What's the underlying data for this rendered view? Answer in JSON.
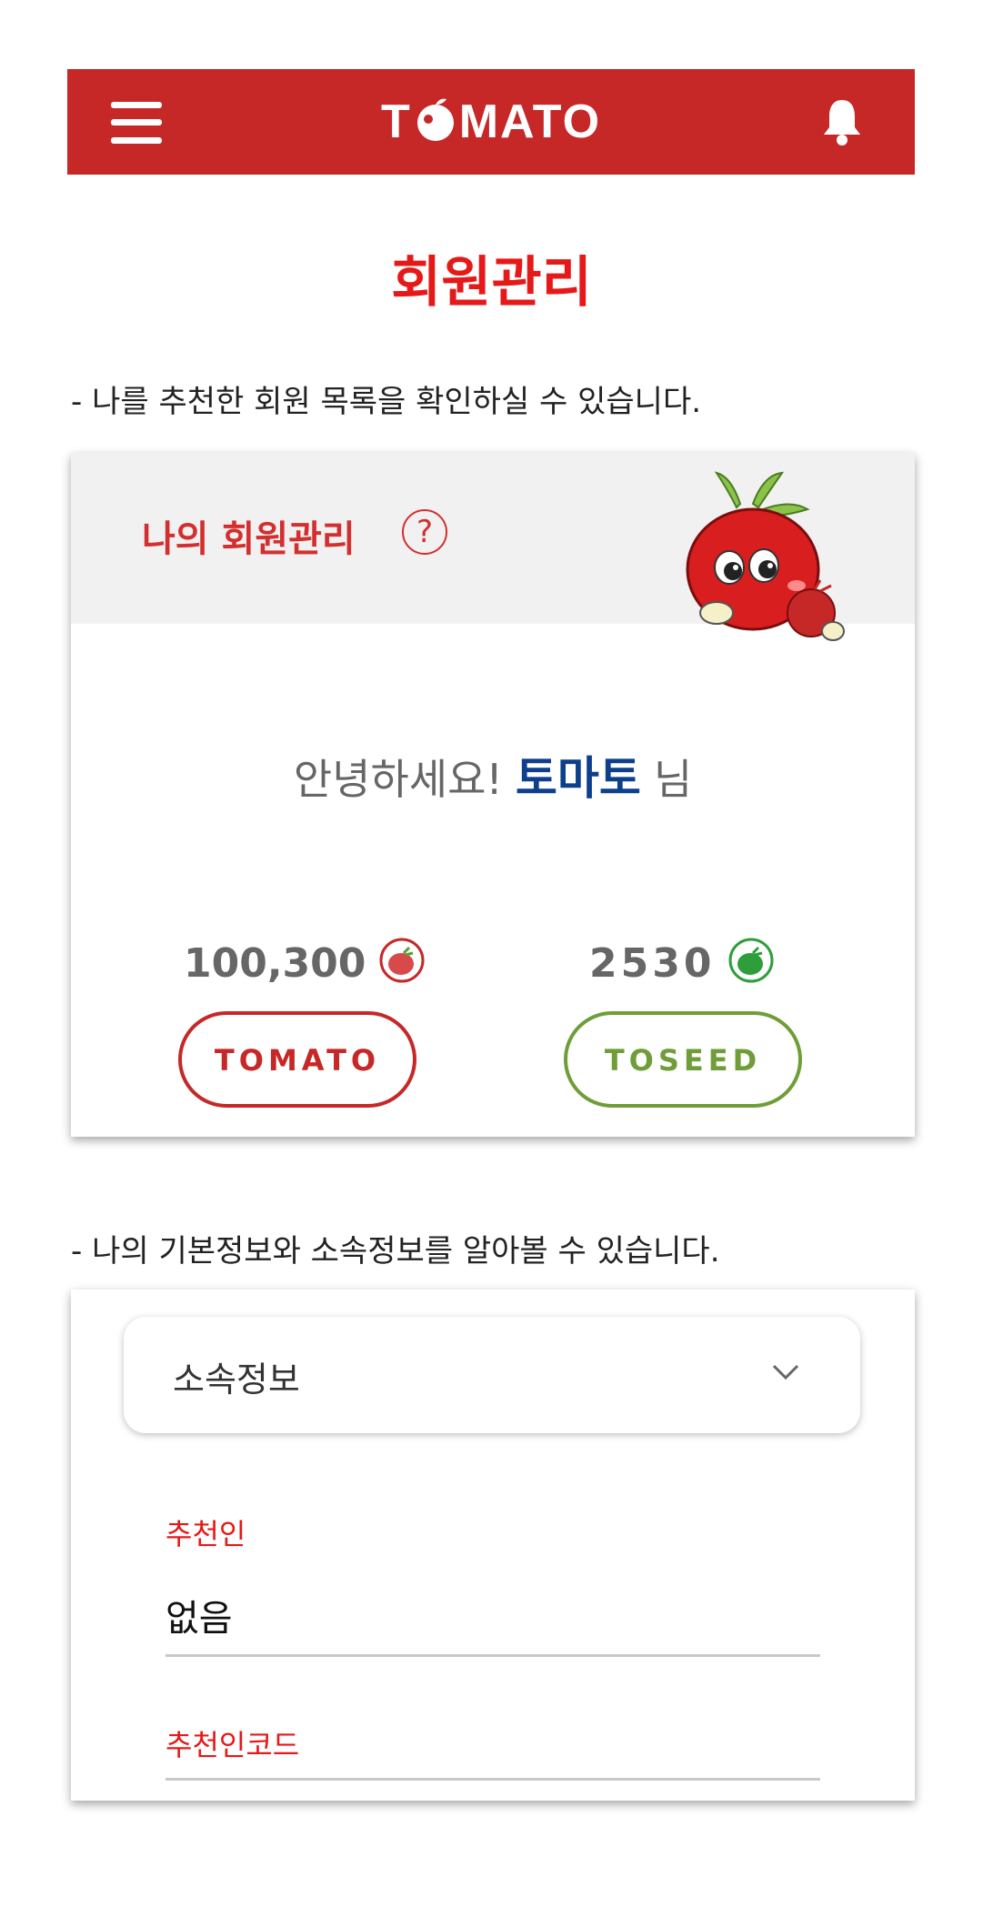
{
  "header": {
    "logo_text": "TOMATO",
    "logo_before": "T",
    "logo_after": "MATO",
    "brand_color": "#c62828",
    "menu_icon": "hamburger-menu-icon",
    "bell_icon": "bell-icon"
  },
  "page": {
    "title": "회원관리",
    "desc1": "- 나를 추천한 회원 목록을 확인하실 수 있습니다.",
    "desc2": "- 나의 기본정보와 소속정보를 알아볼 수 있습니다."
  },
  "member_card": {
    "title": "나의 회원관리",
    "help_glyph": "?",
    "greeting_prefix": "안녕하세요!",
    "user_name": "토마토",
    "greeting_suffix": "님",
    "tomato_balance": "100,300",
    "toseed_balance": "2530",
    "tomato_button": "TOMATO",
    "toseed_button": "TOSEED",
    "tomato_color": "#c62828",
    "toseed_color": "#6f9e38"
  },
  "affiliation": {
    "dropdown_label": "소속정보",
    "recommender_label": "추천인",
    "recommender_value": "없음",
    "recommender_code_label": "추천인코드",
    "recommender_code_value": ""
  }
}
